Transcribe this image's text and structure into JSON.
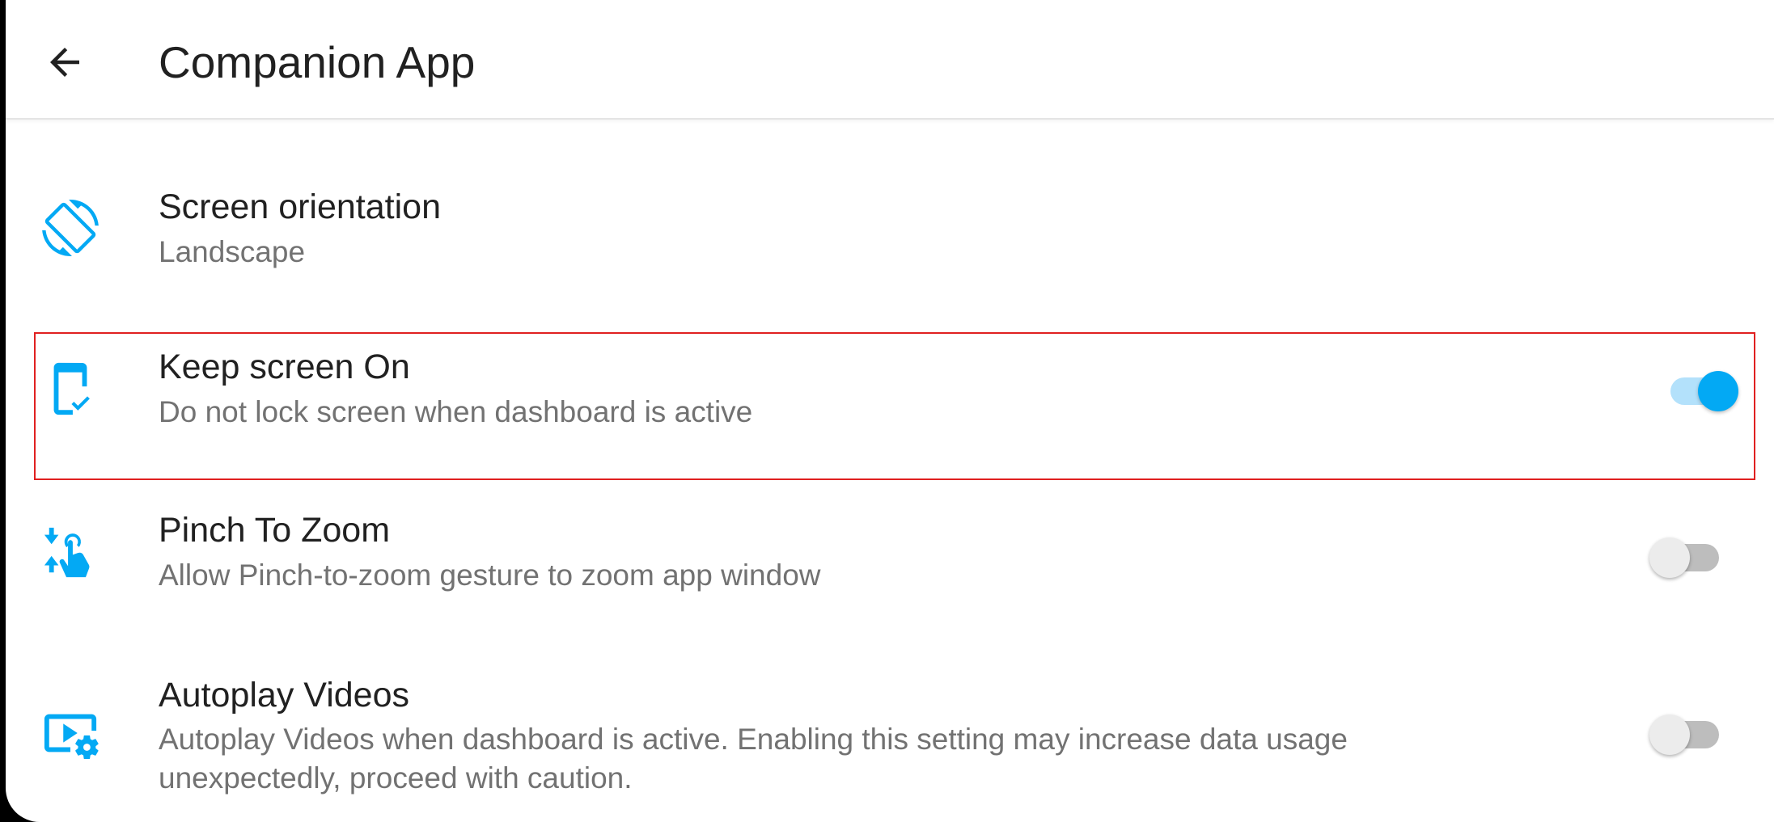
{
  "header": {
    "title": "Companion App",
    "back_icon": "arrow-back-icon"
  },
  "colors": {
    "accent": "#03a9f4",
    "highlight_border": "#e02020"
  },
  "settings": [
    {
      "title": "Screen orientation",
      "subtitle": "Landscape",
      "icon": "screen-rotation-icon"
    },
    {
      "title": "Keep screen On",
      "subtitle": "Do not lock screen when dashboard is active",
      "icon": "phone-lock-icon",
      "toggle_on": true
    },
    {
      "title": "Pinch To Zoom",
      "subtitle": "Allow Pinch-to-zoom gesture to zoom app window",
      "icon": "pinch-gesture-icon",
      "toggle_on": false
    },
    {
      "title": "Autoplay Videos",
      "subtitle": "Autoplay Videos when dashboard is active. Enabling this setting may increase data usage unexpectedly, proceed with caution.",
      "icon": "video-settings-icon",
      "toggle_on": false
    }
  ]
}
